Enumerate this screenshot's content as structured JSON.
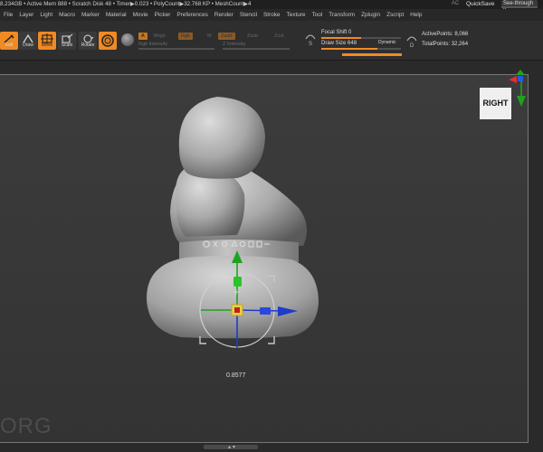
{
  "titlebar": {
    "stats": "8.234GB • Active Mem 888 • Scratch Disk 48 • Timer▶0.023 • PolyCount▶32.768 KP • MeshCount▶4",
    "ac": "AC",
    "quicksave": "QuickSave",
    "seethrough_label": "See-through",
    "seethrough_value": "0",
    "seethrough_fraction": 0
  },
  "menu": [
    "File",
    "Layer",
    "Light",
    "Macro",
    "Marker",
    "Material",
    "Movie",
    "Picker",
    "Preferences",
    "Render",
    "Stencil",
    "Stroke",
    "Texture",
    "Tool",
    "Transform",
    "Zplugin",
    "Zscript",
    "Help"
  ],
  "toolbar": {
    "edit_label": "Edit",
    "draw_label": "Draw",
    "move_label": "Move",
    "scale_label": "Scale",
    "rotate_label": "Rotate",
    "a_label": "A",
    "mrgb_label": "Mrgb",
    "rgb_label": "Rgb",
    "m_label": "M",
    "zadd_label": "Zadd",
    "zsub_label": "Zsub",
    "zcut_label": "Zcut",
    "rgb_intensity_label": "Rgb Intensity",
    "z_intensity_label": "Z Intensity",
    "focal_shift_label": "Focal Shift",
    "focal_shift_value": "0",
    "focal_shift_fraction": 0.5,
    "draw_size_label": "Draw Size",
    "draw_size_value": "648",
    "draw_size_fraction": 0.7,
    "dynamic_label": "Dynamic",
    "active_points_label": "ActivePoints:",
    "active_points_value": "8,066",
    "total_points_label": "TotalPoints:",
    "total_points_value": "32,264"
  },
  "viewport": {
    "view_label": "RIGHT",
    "gizmo_value": "0.8577",
    "watermark": "ORG"
  },
  "colors": {
    "accent": "#f08a24",
    "x_axis": "#1e3cc8",
    "y_axis": "#1fa31f",
    "z_axis": "#1e3cc8"
  }
}
